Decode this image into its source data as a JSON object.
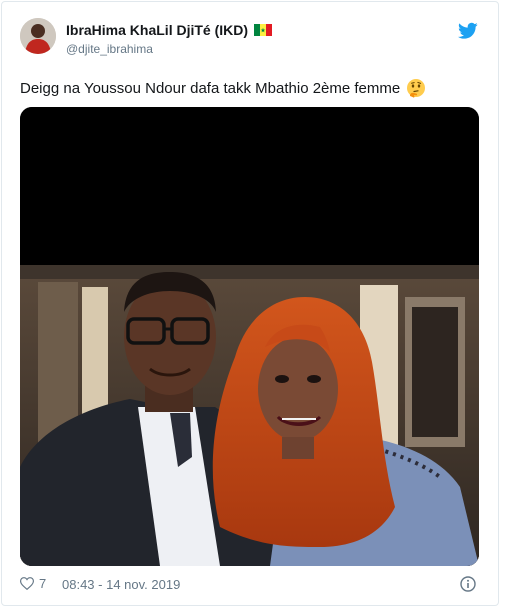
{
  "tweet": {
    "display_name": "IbraHima KhaLil DjiTé (IKD)",
    "handle": "@djite_ibrahima",
    "text": "Deigg na Youssou Ndour dafa takk Mbathio 2ème femme",
    "like_count": "7",
    "timestamp": "08:43 - 14 nov. 2019"
  },
  "icons": {
    "flag": "senegal-flag-icon",
    "brand": "twitter-bird-icon",
    "emoji": "thinking-face-emoji",
    "like": "heart-icon",
    "info": "info-icon"
  },
  "colors": {
    "twitter_blue": "#1da1f2",
    "secondary_text": "#657786",
    "border": "#e1e8ed"
  }
}
